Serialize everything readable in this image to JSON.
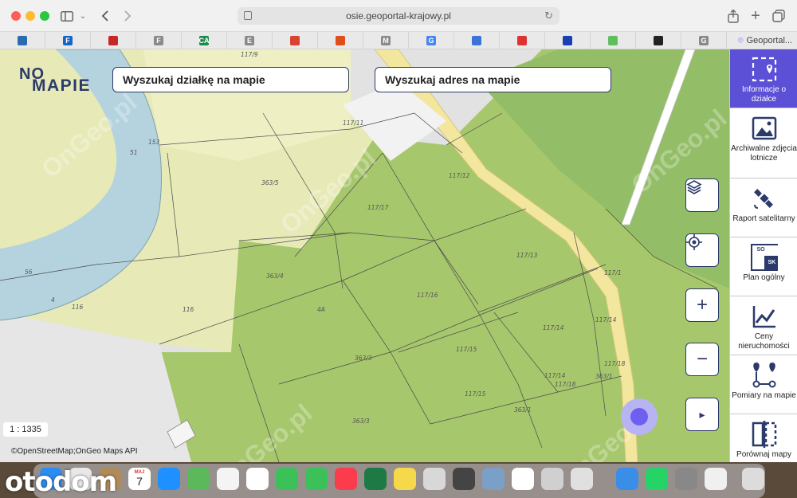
{
  "browser": {
    "url": "osie.geoportal-krajowy.pl",
    "last_tab_label": "Geoportal...",
    "colors": {
      "red": "#fe5f57",
      "yellow": "#febc2e",
      "green": "#28c840"
    }
  },
  "bookmarks": [
    {
      "icon": "layers-favicon",
      "glyph": "",
      "color": "#2b6cb0"
    },
    {
      "icon": "f-favicon",
      "glyph": "F",
      "color": "#1666c7"
    },
    {
      "icon": "emblem-favicon",
      "glyph": "",
      "color": "#c62828"
    },
    {
      "icon": "f-grey-favicon",
      "glyph": "F",
      "color": "#8a8a8a"
    },
    {
      "icon": "ca-favicon",
      "glyph": "CA",
      "color": "#1b8a4a"
    },
    {
      "icon": "e-favicon",
      "glyph": "E",
      "color": "#8a8a8a"
    },
    {
      "icon": "red-square-favicon",
      "glyph": "",
      "color": "#d84332"
    },
    {
      "icon": "orange-favicon",
      "glyph": "",
      "color": "#e04f1a"
    },
    {
      "icon": "m-favicon",
      "glyph": "M",
      "color": "#8a8a8a"
    },
    {
      "icon": "google-favicon",
      "glyph": "G",
      "color": "#4285f4"
    },
    {
      "icon": "blue-building-favicon",
      "glyph": "",
      "color": "#3a74d8"
    },
    {
      "icon": "red-outline-favicon",
      "glyph": "",
      "color": "#d33"
    },
    {
      "icon": "flag-favicon",
      "glyph": "",
      "color": "#1a3fb5"
    },
    {
      "icon": "green-square-favicon",
      "glyph": "",
      "color": "#5fbf5f"
    },
    {
      "icon": "circle-favicon",
      "glyph": "",
      "color": "#222"
    },
    {
      "icon": "g-grey-favicon",
      "glyph": "G",
      "color": "#8a8a8a"
    }
  ],
  "map": {
    "logo_top": "NO",
    "logo_bottom": "MAPIE",
    "search_parcel_label": "Wyszukaj działkę na mapie",
    "search_address_label": "Wyszukaj adres na mapie",
    "scale": "1 : 1335",
    "attribution": "©OpenStreetMap;OnGeo Maps API",
    "watermark": "OnGeo.pl",
    "parcel_labels": [
      "117/9",
      "117/11",
      "153",
      "51",
      "363/5",
      "117/12",
      "117/17",
      "56",
      "4",
      "116",
      "116",
      "363/4",
      "4A",
      "117/16",
      "117/13",
      "117/1",
      "117/14",
      "117/14",
      "117/15",
      "363/3",
      "117/18",
      "117/14",
      "117/18",
      "363/1",
      "117/15",
      "363/1",
      "363/3"
    ],
    "colors": {
      "river": "#b5d3df",
      "light_green": "#e6eab6",
      "green": "#a9c96e",
      "dark_green": "#98c06a",
      "road": "#f3e7a0"
    }
  },
  "controls": {
    "layers": "layers-icon",
    "locate": "locate-icon",
    "zoom_in": "+",
    "zoom_out": "−",
    "expand": "▸"
  },
  "sidebar": {
    "items": [
      {
        "label": "Informacje o działce",
        "icon": "parcel-info-icon",
        "active": true
      },
      {
        "label": "Archiwalne zdjęcia lotnicze",
        "icon": "aerial-photo-icon"
      },
      {
        "label": "Raport satelitarny",
        "icon": "satellite-icon"
      },
      {
        "label": "Plan ogólny",
        "icon": "general-plan-icon",
        "badge_top": "SO",
        "badge_bottom": "SK"
      },
      {
        "label": "Ceny nieruchomości",
        "icon": "price-chart-icon"
      },
      {
        "label": "Pomiary na mapie",
        "icon": "measure-icon"
      },
      {
        "label": "Porównaj mapy",
        "icon": "compare-maps-icon"
      }
    ]
  },
  "dock": {
    "watermark": "otodom",
    "calendar_month": "MAJ",
    "calendar_day": "7"
  }
}
